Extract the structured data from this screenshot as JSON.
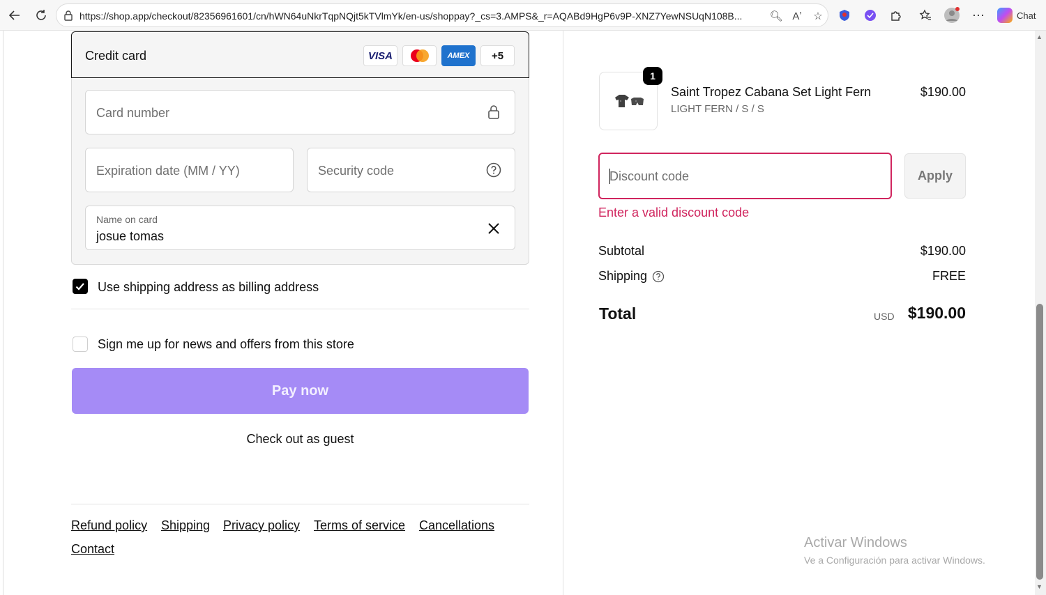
{
  "browser": {
    "url": "https://shop.app/checkout/82356961601/cn/hWN64uNkrTqpNQjt5kTVlmYk/en-us/shoppay?_cs=3.AMPS&_r=AQABd9HgP6v9P-XNZ7YewNSUqN108B...",
    "chat_label": "Chat"
  },
  "payment": {
    "method_title": "Credit card",
    "card_brands": [
      "VISA",
      "Mastercard",
      "AMEX"
    ],
    "more_brands": "+5",
    "card_number_placeholder": "Card number",
    "expiration_placeholder": "Expiration date (MM / YY)",
    "security_placeholder": "Security code",
    "name_label": "Name on card",
    "name_value": "josue tomas"
  },
  "options": {
    "billing_label": "Use shipping address as billing address",
    "billing_checked": true,
    "newsletter_label": "Sign me up for news and offers from this store",
    "newsletter_checked": false
  },
  "actions": {
    "pay_now": "Pay now",
    "guest": "Check out as guest"
  },
  "footer": {
    "links": [
      "Refund policy",
      "Shipping",
      "Privacy policy",
      "Terms of service",
      "Cancellations",
      "Contact"
    ]
  },
  "summary": {
    "quantity": "1",
    "product_name": "Saint Tropez Cabana Set Light Fern",
    "variant": "LIGHT FERN / S / S",
    "price": "$190.00",
    "discount_placeholder": "Discount code",
    "apply_label": "Apply",
    "discount_error": "Enter a valid discount code",
    "subtotal_label": "Subtotal",
    "subtotal_value": "$190.00",
    "shipping_label": "Shipping",
    "shipping_value": "FREE",
    "total_label": "Total",
    "currency": "USD",
    "total_value": "$190.00"
  },
  "watermark": {
    "line1": "Activar Windows",
    "line2": "Ve a Configuración para activar Windows."
  },
  "colors": {
    "accent_error": "#d0255e",
    "pay_button": "#a58bf6"
  }
}
